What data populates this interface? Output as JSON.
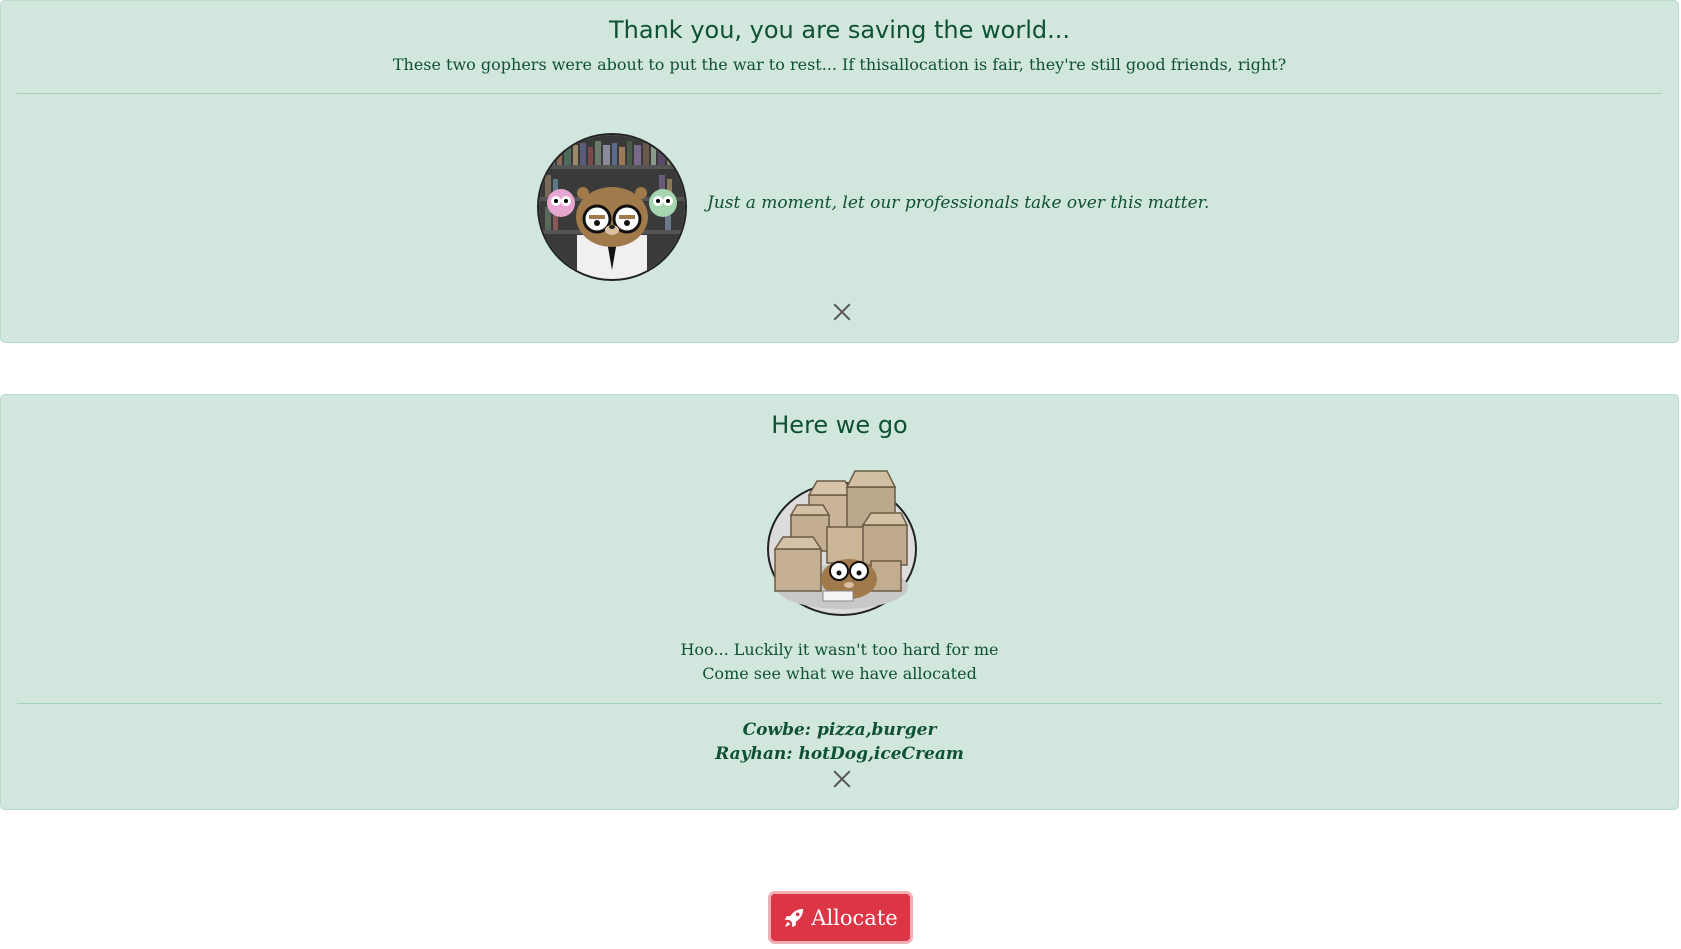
{
  "alert_intro": {
    "heading": "Thank you, you are saving the world...",
    "lead": "These two gophers were about to put the war to rest... If thisallocation is fair, they're still good friends, right?",
    "quote": "Just a moment, let our professionals take over this matter.",
    "avatar_icon": "professor-gopher-icon",
    "close_icon": "close-icon"
  },
  "alert_result": {
    "heading": "Here we go",
    "line_1": "Hoo... Luckily it wasn't too hard for me",
    "line_2": "Come see what we have allocated",
    "results": [
      "Cowbe: pizza,burger",
      "Rayhan: hotDog,iceCream"
    ],
    "avatar_icon": "boxes-gopher-icon",
    "close_icon": "close-icon"
  },
  "allocate_button": {
    "label": "Allocate",
    "icon": "rocket-icon"
  },
  "colors": {
    "alert_bg": "#d1e7dd",
    "alert_text": "#0f5132",
    "button_bg": "#dc3545"
  }
}
